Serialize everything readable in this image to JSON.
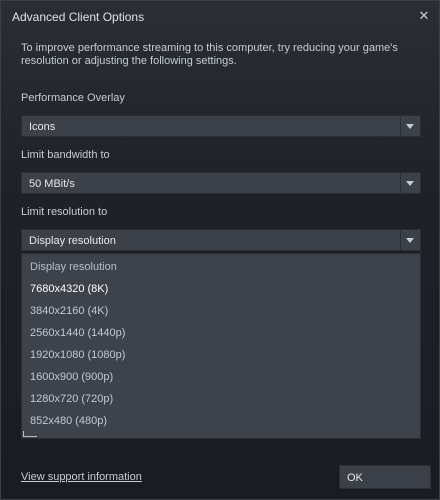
{
  "window": {
    "title": "Advanced Client Options",
    "close_glyph": "✕"
  },
  "intro": "To improve performance streaming to this computer, try reducing your game's resolution or adjusting the following settings.",
  "performance_overlay": {
    "label": "Performance Overlay",
    "value": "Icons"
  },
  "bandwidth": {
    "label": "Limit bandwidth to",
    "value": "50 MBit/s"
  },
  "resolution": {
    "label": "Limit resolution to",
    "value": "Display resolution",
    "options": [
      "Display resolution",
      "7680x4320 (8K)",
      "3840x2160 (4K)",
      "2560x1440 (1440p)",
      "1920x1080 (1080p)",
      "1600x900 (900p)",
      "1280x720 (720p)",
      "852x480 (480p)"
    ],
    "highlighted_option": "7680x4320 (8K)"
  },
  "footer": {
    "support_link": "View support information",
    "ok_label": "OK"
  },
  "icons": {
    "close": "close-icon",
    "dropdown_arrow": "chevron-down-icon"
  }
}
